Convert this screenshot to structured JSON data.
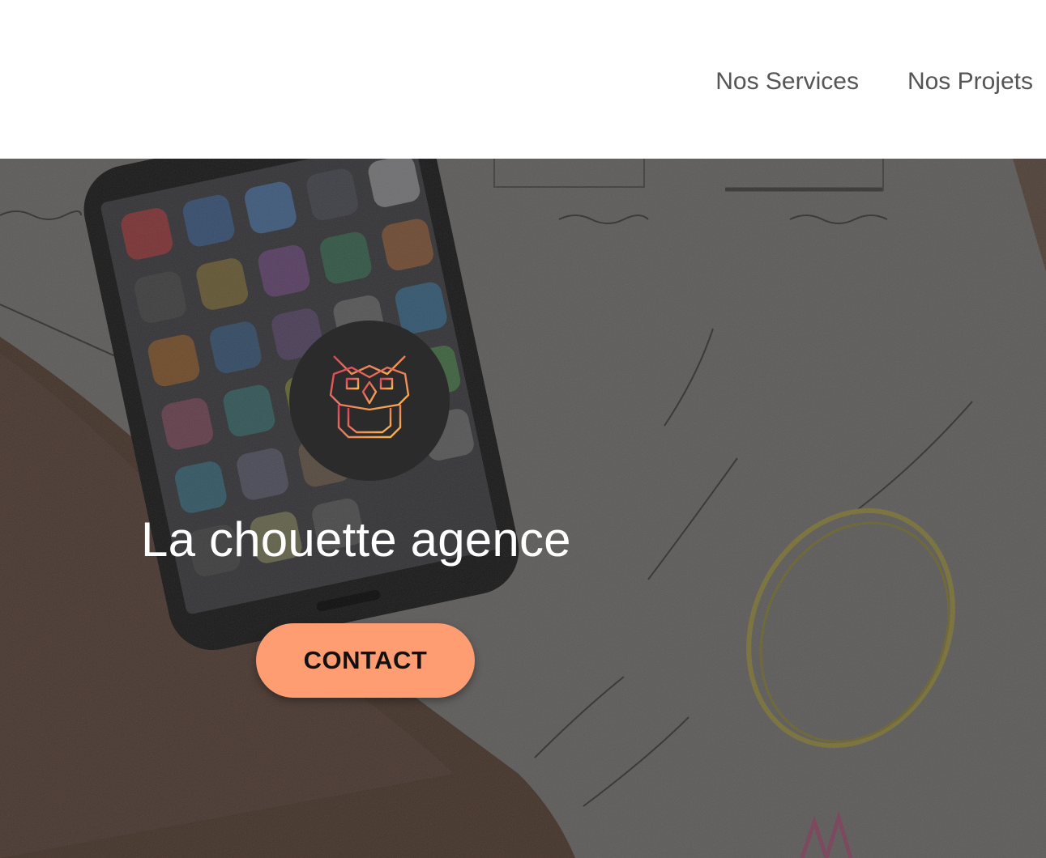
{
  "nav": {
    "items": [
      {
        "label": "Nos Services"
      },
      {
        "label": "Nos Projets"
      }
    ]
  },
  "hero": {
    "title": "La chouette agence",
    "contact_label": "CONTACT",
    "logo_icon": "owl-icon"
  },
  "colors": {
    "button": "#fe9c72",
    "logo_bg": "#2b2b2b",
    "nav_text": "#555555",
    "title_text": "#ffffff",
    "owl_gradient_start": "#e0405a",
    "owl_gradient_end": "#f7b955"
  }
}
